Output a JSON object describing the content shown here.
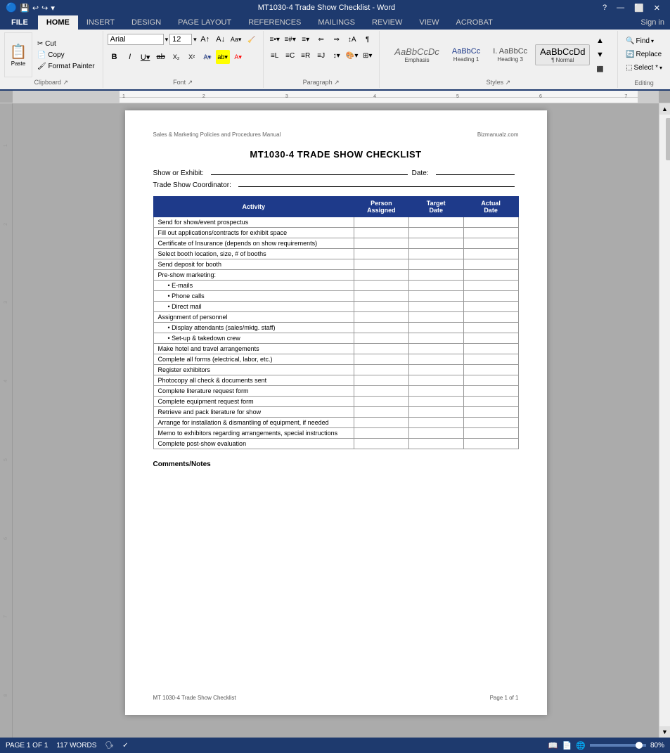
{
  "titleBar": {
    "title": "MT1030-4 Trade Show Checklist - Word",
    "controls": [
      "?",
      "—",
      "⬜",
      "✕"
    ]
  },
  "ribbon": {
    "fileTab": "FILE",
    "tabs": [
      "HOME",
      "INSERT",
      "DESIGN",
      "PAGE LAYOUT",
      "REFERENCES",
      "MAILINGS",
      "REVIEW",
      "VIEW",
      "ACROBAT"
    ],
    "activeTab": "HOME",
    "signIn": "Sign in",
    "fontName": "Arial",
    "fontSize": "12",
    "styles": [
      {
        "label": "Emphasis",
        "preview": "AaBbCcDc",
        "style": "italic"
      },
      {
        "label": "Heading 1",
        "preview": "AaBbCc",
        "style": "normal"
      },
      {
        "label": "Heading 3",
        "preview": "I. AaBbCc",
        "style": "normal"
      },
      {
        "label": "Normal",
        "preview": "AaBbCcDd",
        "style": "normal"
      }
    ],
    "editing": {
      "find": "Find",
      "replace": "Replace",
      "select": "Select *"
    }
  },
  "document": {
    "headerLeft": "Sales & Marketing Policies and Procedures Manual",
    "headerRight": "Bizmanualz.com",
    "title": "MT1030-4 TRADE SHOW CHECKLIST",
    "showOrExhibitLabel": "Show or Exhibit:",
    "dateLabel": "Date:",
    "coordinatorLabel": "Trade Show Coordinator:",
    "table": {
      "headers": [
        "Activity",
        "Person Assigned",
        "Target Date",
        "Actual Date"
      ],
      "rows": [
        {
          "activity": "Send for show/event prospectus",
          "bullet": false
        },
        {
          "activity": "Fill out applications/contracts for exhibit space",
          "bullet": false
        },
        {
          "activity": "Certificate of Insurance (depends on show requirements)",
          "bullet": false
        },
        {
          "activity": "Select booth location, size, # of booths",
          "bullet": false
        },
        {
          "activity": "Send deposit for booth",
          "bullet": false
        },
        {
          "activity": "Pre-show marketing:",
          "bullet": false
        },
        {
          "activity": "E-mails",
          "bullet": true
        },
        {
          "activity": "Phone calls",
          "bullet": true
        },
        {
          "activity": "Direct mail",
          "bullet": true
        },
        {
          "activity": "Assignment of personnel",
          "bullet": false
        },
        {
          "activity": "Display attendants (sales/mktg. staff)",
          "bullet": true
        },
        {
          "activity": "Set-up & takedown crew",
          "bullet": true
        },
        {
          "activity": "Make hotel and travel arrangements",
          "bullet": false
        },
        {
          "activity": "Complete all forms (electrical, labor, etc.)",
          "bullet": false
        },
        {
          "activity": "Register exhibitors",
          "bullet": false
        },
        {
          "activity": "Photocopy all check & documents sent",
          "bullet": false
        },
        {
          "activity": "Complete literature request form",
          "bullet": false
        },
        {
          "activity": "Complete equipment request form",
          "bullet": false
        },
        {
          "activity": "Retrieve and pack literature for show",
          "bullet": false
        },
        {
          "activity": "Arrange for installation & dismantling of equipment, if needed",
          "bullet": false
        },
        {
          "activity": "Memo to exhibitors regarding arrangements, special instructions",
          "bullet": false
        },
        {
          "activity": "Complete post-show evaluation",
          "bullet": false
        }
      ]
    },
    "commentsLabel": "Comments/Notes",
    "footerLeft": "MT 1030-4 Trade Show Checklist",
    "footerRight": "Page 1 of 1"
  },
  "statusBar": {
    "pageInfo": "PAGE 1 OF 1",
    "wordCount": "117 WORDS",
    "zoom": "80%"
  }
}
